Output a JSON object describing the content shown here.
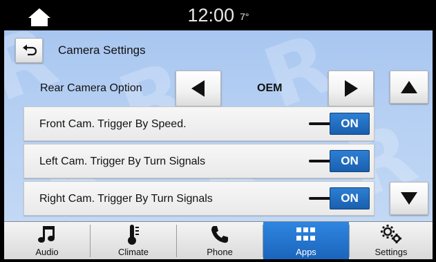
{
  "status": {
    "time": "12:00",
    "temperature": "7°"
  },
  "header": {
    "title": "Camera Settings"
  },
  "rear_camera": {
    "label": "Rear Camera Option",
    "value": "OEM"
  },
  "rows": [
    {
      "label": "Front Cam. Trigger By Speed.",
      "state": "ON"
    },
    {
      "label": "Left Cam. Trigger By Turn Signals",
      "state": "ON"
    },
    {
      "label": "Right Cam. Trigger By Turn Signals",
      "state": "ON"
    }
  ],
  "nav": [
    {
      "label": "Audio",
      "icon": "music-note-icon",
      "active": false
    },
    {
      "label": "Climate",
      "icon": "thermometer-icon",
      "active": false
    },
    {
      "label": "Phone",
      "icon": "phone-icon",
      "active": false
    },
    {
      "label": "Apps",
      "icon": "apps-grid-icon",
      "active": true
    },
    {
      "label": "Settings",
      "icon": "gears-icon",
      "active": false
    }
  ],
  "colors": {
    "accent": "#1f6fc6",
    "background": "#b6d0f3",
    "statusbar": "#000000"
  }
}
